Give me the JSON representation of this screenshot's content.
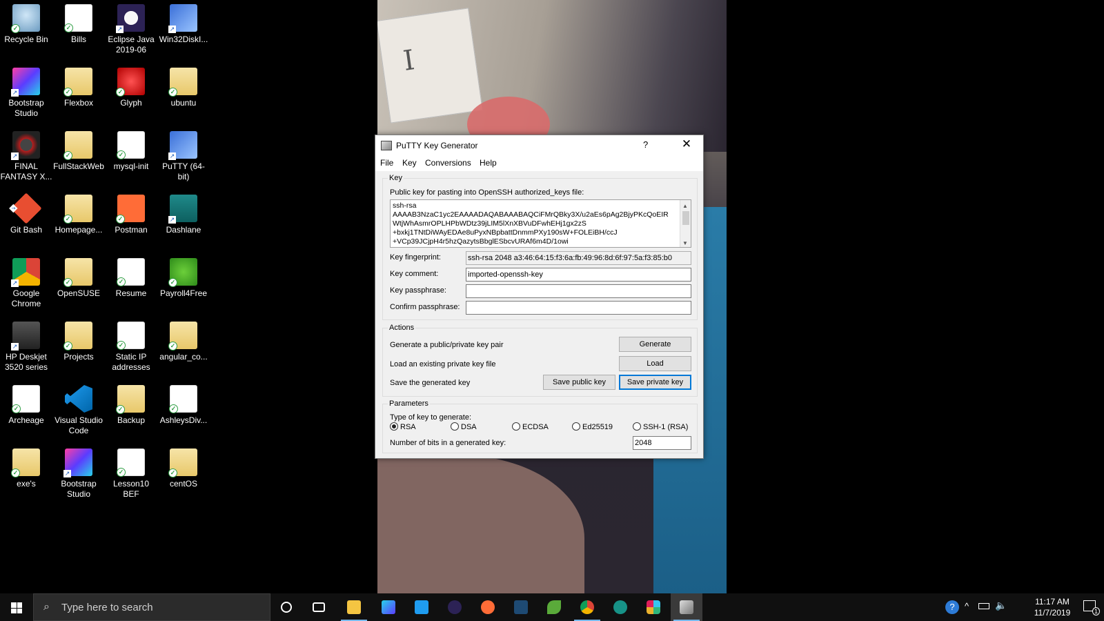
{
  "desktop_icons": [
    {
      "label": "Recycle Bin",
      "icon": "recycle-bin-icon"
    },
    {
      "label": "Bills",
      "icon": "document-icon"
    },
    {
      "label": "Eclipse Java 2019-06",
      "icon": "eclipse-icon"
    },
    {
      "label": "Win32DiskI...",
      "icon": "disk-imager-icon"
    },
    {
      "label": "Bootstrap Studio",
      "icon": "bootstrap-studio-icon"
    },
    {
      "label": "Flexbox",
      "icon": "folder-icon"
    },
    {
      "label": "Glyph",
      "icon": "glyph-icon"
    },
    {
      "label": "ubuntu",
      "icon": "folder-icon"
    },
    {
      "label": "FINAL FANTASY X...",
      "icon": "final-fantasy-icon"
    },
    {
      "label": "FullStackWeb",
      "icon": "folder-icon"
    },
    {
      "label": "mysql-init",
      "icon": "document-icon"
    },
    {
      "label": "PuTTY (64-bit)",
      "icon": "putty-icon"
    },
    {
      "label": "Git Bash",
      "icon": "git-icon"
    },
    {
      "label": "Homepage...",
      "icon": "folder-icon"
    },
    {
      "label": "Postman",
      "icon": "postman-icon"
    },
    {
      "label": "Dashlane",
      "icon": "dashlane-icon"
    },
    {
      "label": "Google Chrome",
      "icon": "chrome-icon"
    },
    {
      "label": "OpenSUSE",
      "icon": "folder-icon"
    },
    {
      "label": "Resume",
      "icon": "document-icon"
    },
    {
      "label": "Payroll4Free",
      "icon": "payroll-icon"
    },
    {
      "label": "HP Deskjet 3520 series",
      "icon": "printer-icon"
    },
    {
      "label": "Projects",
      "icon": "folder-icon"
    },
    {
      "label": "Static IP addresses",
      "icon": "document-icon"
    },
    {
      "label": "angular_co...",
      "icon": "folder-icon"
    },
    {
      "label": "Archeage",
      "icon": "document-icon"
    },
    {
      "label": "Visual Studio Code",
      "icon": "vscode-icon"
    },
    {
      "label": "Backup",
      "icon": "folder-icon"
    },
    {
      "label": "AshleysDiv...",
      "icon": "document-icon"
    },
    {
      "label": "exe's",
      "icon": "folder-icon"
    },
    {
      "label": "Bootstrap Studio",
      "icon": "bootstrap-studio-icon"
    },
    {
      "label": "Lesson10 BEF",
      "icon": "document-icon"
    },
    {
      "label": "centOS",
      "icon": "folder-icon"
    }
  ],
  "putty": {
    "title": "PuTTY Key Generator",
    "help_glyph": "?",
    "close_glyph": "✕",
    "menu": [
      "File",
      "Key",
      "Conversions",
      "Help"
    ],
    "key_group": "Key",
    "public_key_label": "Public key for pasting into OpenSSH authorized_keys file:",
    "public_key_lines": [
      "ssh-rsa",
      "AAAAB3NzaC1yc2EAAAADAQABAAABAQCiFMrQBky3X/u2aEs6pAg2BjyPKcQoEIR",
      "WtjWhAsmrOPLHPbWDtz39jLIM5lXnXBVuDFwhEHj1gx2zS",
      "+bxkj1TNtDiWAyEDAe8uPyxNBpbattDnmmPXy190sW+FOLEiBH/ccJ",
      "+VCp39JCjpH4r5hzQazytsBbglESbcvURAf6m4D/1owi"
    ],
    "fingerprint_label": "Key fingerprint:",
    "fingerprint_value": "ssh-rsa 2048 a3:46:64:15:f3:6a:fb:49:96:8d:6f:97:5a:f3:85:b0",
    "comment_label": "Key comment:",
    "comment_value": "imported-openssh-key",
    "passphrase_label": "Key passphrase:",
    "passphrase_value": "",
    "confirm_label": "Confirm passphrase:",
    "confirm_value": "",
    "actions_group": "Actions",
    "generate_desc": "Generate a public/private key pair",
    "generate_btn": "Generate",
    "load_desc": "Load an existing private key file",
    "load_btn": "Load",
    "save_desc": "Save the generated key",
    "save_public_btn": "Save public key",
    "save_private_btn": "Save private key",
    "params_group": "Parameters",
    "type_label": "Type of key to generate:",
    "key_types": [
      "RSA",
      "DSA",
      "ECDSA",
      "Ed25519",
      "SSH-1 (RSA)"
    ],
    "selected_type": "RSA",
    "bits_label": "Number of bits in a generated key:",
    "bits_value": "2048"
  },
  "taskbar": {
    "search_placeholder": "Type here to search",
    "time": "11:17 AM",
    "date": "11/7/2019",
    "notification_count": "1",
    "apps": [
      "cortana-icon",
      "task-view-icon",
      "file-explorer-icon",
      "bootstrap-studio-icon",
      "vscode-icon",
      "eclipse-icon",
      "postman-icon",
      "mysql-workbench-icon",
      "leaf-icon",
      "chrome-icon",
      "gitkraken-icon",
      "slack-icon",
      "puttygen-icon"
    ]
  }
}
